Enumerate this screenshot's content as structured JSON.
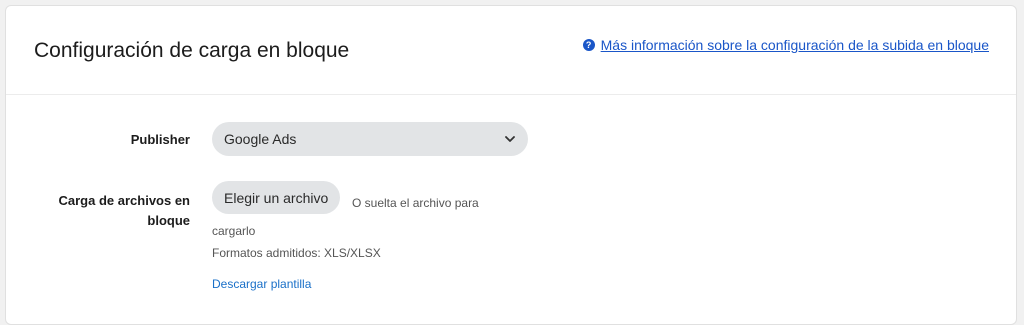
{
  "header": {
    "title": "Configuración de carga en bloque",
    "help_link": "Más información sobre la configuración de la subida en bloque",
    "help_icon": "question-circle-icon"
  },
  "form": {
    "publisher": {
      "label": "Publisher",
      "selected": "Google Ads"
    },
    "upload": {
      "label": "Carga de archivos en bloque",
      "button": "Elegir un archivo",
      "drop_text": "O suelta el archivo para cargarlo",
      "formats": "Formatos admitidos: XLS/XLSX",
      "template_link": "Descargar plantilla"
    }
  },
  "colors": {
    "link": "#1a56c8",
    "control_bg": "#e2e4e6"
  }
}
